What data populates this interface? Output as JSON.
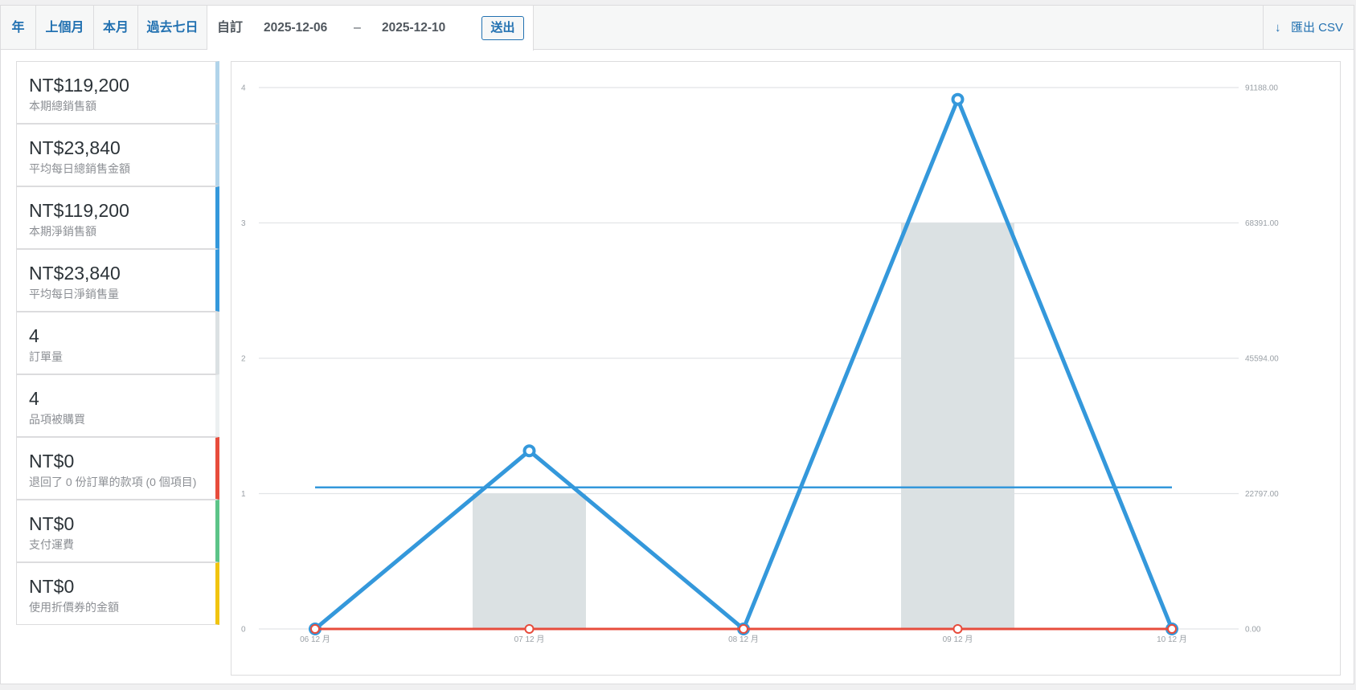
{
  "ranges": {
    "year": "年",
    "last_month": "上個月",
    "this_month": "本月",
    "last_7_days": "過去七日",
    "custom": "自訂"
  },
  "custom_range": {
    "start": "2025-12-06",
    "separator": "–",
    "end": "2025-12-10",
    "submit": "送出"
  },
  "export": {
    "arrow": "↓",
    "label": "匯出 CSV"
  },
  "legend": [
    {
      "amount": "NT$119,200",
      "caption": "本期總銷售額",
      "color": "#b1d4ea"
    },
    {
      "amount": "NT$23,840",
      "caption": "平均每日總銷售金額",
      "color": "#b1d4ea"
    },
    {
      "amount": "NT$119,200",
      "caption": "本期淨銷售額",
      "color": "#3498db"
    },
    {
      "amount": "NT$23,840",
      "caption": "平均每日淨銷售量",
      "color": "#3498db"
    },
    {
      "amount": "4",
      "caption": "訂單量",
      "color": "#dbe1e3"
    },
    {
      "amount": "4",
      "caption": "品項被購買",
      "color": "#ecf0f1"
    },
    {
      "amount": "NT$0",
      "caption": "退回了 0 份訂單的款項 (0 個項目)",
      "color": "#e74c3c"
    },
    {
      "amount": "NT$0",
      "caption": "支付運費",
      "color": "#5cc488"
    },
    {
      "amount": "NT$0",
      "caption": "使用折價券的金額",
      "color": "#f1c40f"
    }
  ],
  "chart_data": {
    "type": "bar",
    "x": [
      "06 12 月",
      "07 12 月",
      "08 12 月",
      "09 12 月",
      "10 12 月"
    ],
    "left_axis": {
      "ticks": [
        "0",
        "1",
        "2",
        "3",
        "4"
      ],
      "ylim": [
        0,
        4
      ]
    },
    "right_axis": {
      "ticks": [
        "0.00",
        "22797.00",
        "45594.00",
        "68391.00",
        "91188.00"
      ],
      "ylim": [
        0,
        91188
      ]
    },
    "series": [
      {
        "kind": "bar",
        "axis": "left",
        "values": [
          0,
          1,
          0,
          3,
          0
        ],
        "color": "#dbe1e3"
      },
      {
        "kind": "line",
        "axis": "right",
        "values": [
          0,
          30000,
          0,
          89200,
          0
        ],
        "color": "#3498db",
        "markers": true
      },
      {
        "kind": "hline",
        "axis": "right",
        "values": [
          23840,
          23840,
          23840,
          23840,
          23840
        ],
        "color": "#3498db"
      },
      {
        "kind": "line",
        "axis": "right",
        "values": [
          0,
          0,
          0,
          0,
          0
        ],
        "color": "#e74c3c",
        "markers": true
      }
    ],
    "grid": true
  }
}
